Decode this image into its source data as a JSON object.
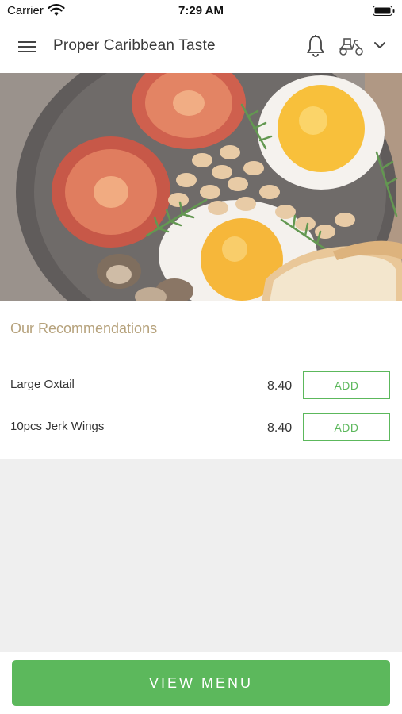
{
  "status_bar": {
    "carrier": "Carrier",
    "time": "7:29 AM"
  },
  "header": {
    "title": "Proper Caribbean Taste",
    "icons": [
      "menu-icon",
      "bell-icon",
      "delivery-scooter-icon",
      "chevron-down-icon"
    ]
  },
  "hero": {
    "image": "breakfast-plate-photo"
  },
  "recommendations": {
    "title": "Our Recommendations",
    "items": [
      {
        "name": "Large Oxtail",
        "price": "8.40",
        "button": "ADD"
      },
      {
        "name": "10pcs Jerk Wings",
        "price": "8.40",
        "button": "ADD"
      }
    ]
  },
  "footer": {
    "view_menu_label": "VIEW MENU"
  },
  "colors": {
    "accent": "#5cb85c",
    "section_title": "#b6a27c",
    "background": "#efefef"
  }
}
